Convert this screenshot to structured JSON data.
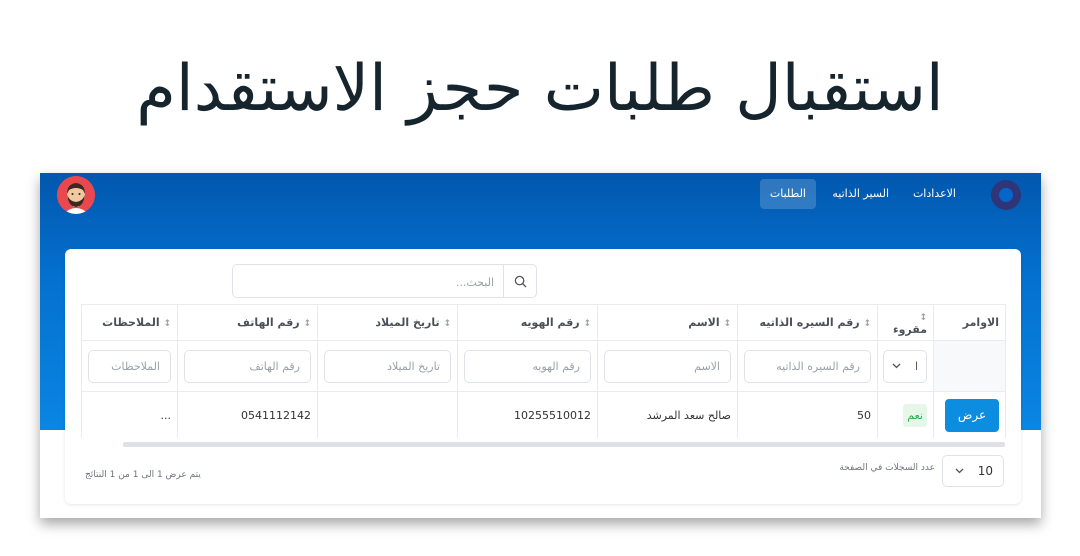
{
  "page_title": "استقبال طلبات حجز الاستقدام",
  "nav": {
    "items": [
      {
        "label": "الطلبات",
        "active": true
      },
      {
        "label": "السير الذاتيه",
        "active": false
      },
      {
        "label": "الاعدادات",
        "active": false
      }
    ]
  },
  "search": {
    "placeholder": "البحث..."
  },
  "table": {
    "headers": [
      "الاوامر",
      "مقروء",
      "رقم السيره الذاتيه",
      "الاسم",
      "رقم الهويه",
      "تاريخ الميلاد",
      "رقم الهاتف",
      "الملاحظات"
    ],
    "filter_placeholders": [
      "رقم السيره الذاتيه",
      "الاسم",
      "رقم الهويه",
      "تاريخ الميلاد",
      "رقم الهاتف",
      "الملاحظات"
    ],
    "read_filter_value": "ا",
    "rows": [
      {
        "action": "عرض",
        "read": "نعم",
        "cv_number": "50",
        "name": "صالح سعد المرشد",
        "id_number": "10255510012",
        "birth_date": "",
        "phone": "0541112142",
        "notes": "..."
      }
    ]
  },
  "pager": {
    "page_size": "10",
    "page_size_label": "عدد السجلات في الصفحة",
    "summary": "يتم عرض 1 الى 1 من 1 النتائج"
  },
  "icons": {
    "search": "search-icon",
    "sort": "sort-icon",
    "chevron": "chevron-down-icon",
    "logo": "logo-icon",
    "avatar": "avatar"
  },
  "colors": {
    "primary": "#0d8ddf",
    "band_top": "#0257ad",
    "band_bottom": "#0a86e2",
    "success": "#2eaa4f",
    "title": "#16242d"
  }
}
